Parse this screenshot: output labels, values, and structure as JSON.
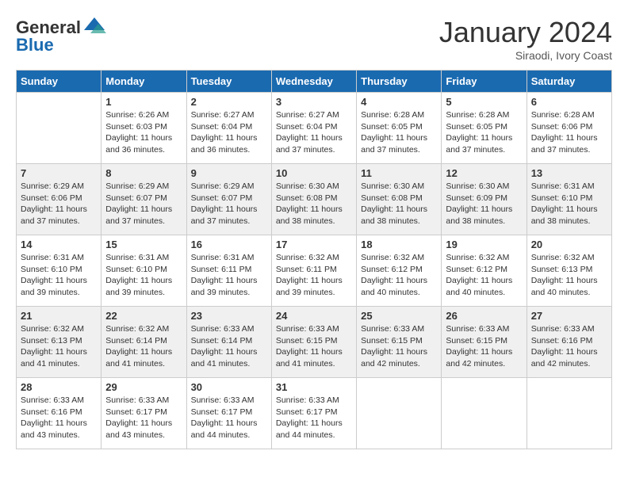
{
  "logo": {
    "text_general": "General",
    "text_blue": "Blue"
  },
  "title": "January 2024",
  "subtitle": "Siraodi, Ivory Coast",
  "days_of_week": [
    "Sunday",
    "Monday",
    "Tuesday",
    "Wednesday",
    "Thursday",
    "Friday",
    "Saturday"
  ],
  "weeks": [
    [
      {
        "day": "",
        "content": ""
      },
      {
        "day": "1",
        "content": "Sunrise: 6:26 AM\nSunset: 6:03 PM\nDaylight: 11 hours and 36 minutes."
      },
      {
        "day": "2",
        "content": "Sunrise: 6:27 AM\nSunset: 6:04 PM\nDaylight: 11 hours and 36 minutes."
      },
      {
        "day": "3",
        "content": "Sunrise: 6:27 AM\nSunset: 6:04 PM\nDaylight: 11 hours and 37 minutes."
      },
      {
        "day": "4",
        "content": "Sunrise: 6:28 AM\nSunset: 6:05 PM\nDaylight: 11 hours and 37 minutes."
      },
      {
        "day": "5",
        "content": "Sunrise: 6:28 AM\nSunset: 6:05 PM\nDaylight: 11 hours and 37 minutes."
      },
      {
        "day": "6",
        "content": "Sunrise: 6:28 AM\nSunset: 6:06 PM\nDaylight: 11 hours and 37 minutes."
      }
    ],
    [
      {
        "day": "7",
        "content": "Sunrise: 6:29 AM\nSunset: 6:06 PM\nDaylight: 11 hours and 37 minutes."
      },
      {
        "day": "8",
        "content": "Sunrise: 6:29 AM\nSunset: 6:07 PM\nDaylight: 11 hours and 37 minutes."
      },
      {
        "day": "9",
        "content": "Sunrise: 6:29 AM\nSunset: 6:07 PM\nDaylight: 11 hours and 37 minutes."
      },
      {
        "day": "10",
        "content": "Sunrise: 6:30 AM\nSunset: 6:08 PM\nDaylight: 11 hours and 38 minutes."
      },
      {
        "day": "11",
        "content": "Sunrise: 6:30 AM\nSunset: 6:08 PM\nDaylight: 11 hours and 38 minutes."
      },
      {
        "day": "12",
        "content": "Sunrise: 6:30 AM\nSunset: 6:09 PM\nDaylight: 11 hours and 38 minutes."
      },
      {
        "day": "13",
        "content": "Sunrise: 6:31 AM\nSunset: 6:10 PM\nDaylight: 11 hours and 38 minutes."
      }
    ],
    [
      {
        "day": "14",
        "content": "Sunrise: 6:31 AM\nSunset: 6:10 PM\nDaylight: 11 hours and 39 minutes."
      },
      {
        "day": "15",
        "content": "Sunrise: 6:31 AM\nSunset: 6:10 PM\nDaylight: 11 hours and 39 minutes."
      },
      {
        "day": "16",
        "content": "Sunrise: 6:31 AM\nSunset: 6:11 PM\nDaylight: 11 hours and 39 minutes."
      },
      {
        "day": "17",
        "content": "Sunrise: 6:32 AM\nSunset: 6:11 PM\nDaylight: 11 hours and 39 minutes."
      },
      {
        "day": "18",
        "content": "Sunrise: 6:32 AM\nSunset: 6:12 PM\nDaylight: 11 hours and 40 minutes."
      },
      {
        "day": "19",
        "content": "Sunrise: 6:32 AM\nSunset: 6:12 PM\nDaylight: 11 hours and 40 minutes."
      },
      {
        "day": "20",
        "content": "Sunrise: 6:32 AM\nSunset: 6:13 PM\nDaylight: 11 hours and 40 minutes."
      }
    ],
    [
      {
        "day": "21",
        "content": "Sunrise: 6:32 AM\nSunset: 6:13 PM\nDaylight: 11 hours and 41 minutes."
      },
      {
        "day": "22",
        "content": "Sunrise: 6:32 AM\nSunset: 6:14 PM\nDaylight: 11 hours and 41 minutes."
      },
      {
        "day": "23",
        "content": "Sunrise: 6:33 AM\nSunset: 6:14 PM\nDaylight: 11 hours and 41 minutes."
      },
      {
        "day": "24",
        "content": "Sunrise: 6:33 AM\nSunset: 6:15 PM\nDaylight: 11 hours and 41 minutes."
      },
      {
        "day": "25",
        "content": "Sunrise: 6:33 AM\nSunset: 6:15 PM\nDaylight: 11 hours and 42 minutes."
      },
      {
        "day": "26",
        "content": "Sunrise: 6:33 AM\nSunset: 6:15 PM\nDaylight: 11 hours and 42 minutes."
      },
      {
        "day": "27",
        "content": "Sunrise: 6:33 AM\nSunset: 6:16 PM\nDaylight: 11 hours and 42 minutes."
      }
    ],
    [
      {
        "day": "28",
        "content": "Sunrise: 6:33 AM\nSunset: 6:16 PM\nDaylight: 11 hours and 43 minutes."
      },
      {
        "day": "29",
        "content": "Sunrise: 6:33 AM\nSunset: 6:17 PM\nDaylight: 11 hours and 43 minutes."
      },
      {
        "day": "30",
        "content": "Sunrise: 6:33 AM\nSunset: 6:17 PM\nDaylight: 11 hours and 44 minutes."
      },
      {
        "day": "31",
        "content": "Sunrise: 6:33 AM\nSunset: 6:17 PM\nDaylight: 11 hours and 44 minutes."
      },
      {
        "day": "",
        "content": ""
      },
      {
        "day": "",
        "content": ""
      },
      {
        "day": "",
        "content": ""
      }
    ]
  ]
}
